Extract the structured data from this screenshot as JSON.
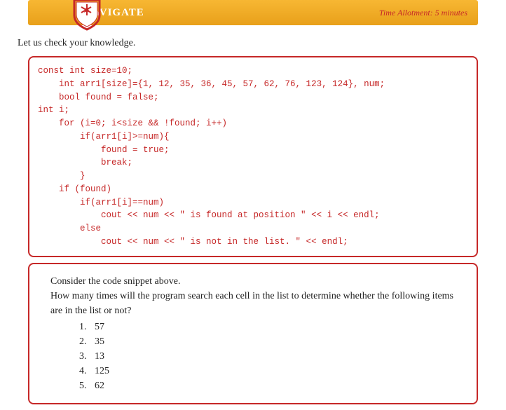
{
  "header": {
    "title": "NAVIGATE",
    "time_allotment": "Time Allotment: 5 minutes"
  },
  "intro": "Let us check your knowledge.",
  "code": "const int size=10;\n    int arr1[size]={1, 12, 35, 36, 45, 57, 62, 76, 123, 124}, num;\n    bool found = false;\nint i;\n    for (i=0; i<size && !found; i++)\n        if(arr1[i]>=num){\n            found = true;\n            break;\n        }\n    if (found)\n        if(arr1[i]==num)\n            cout << num << \" is found at position \" << i << endl;\n        else\n            cout << num << \" is not in the list. \" << endl;",
  "question": {
    "prompt1": "Consider the code snippet above.",
    "prompt2": "How many times will the program search each cell in the list to determine whether the following items are in the list or not?",
    "items": [
      "57",
      "35",
      "13",
      "125",
      "62"
    ]
  }
}
